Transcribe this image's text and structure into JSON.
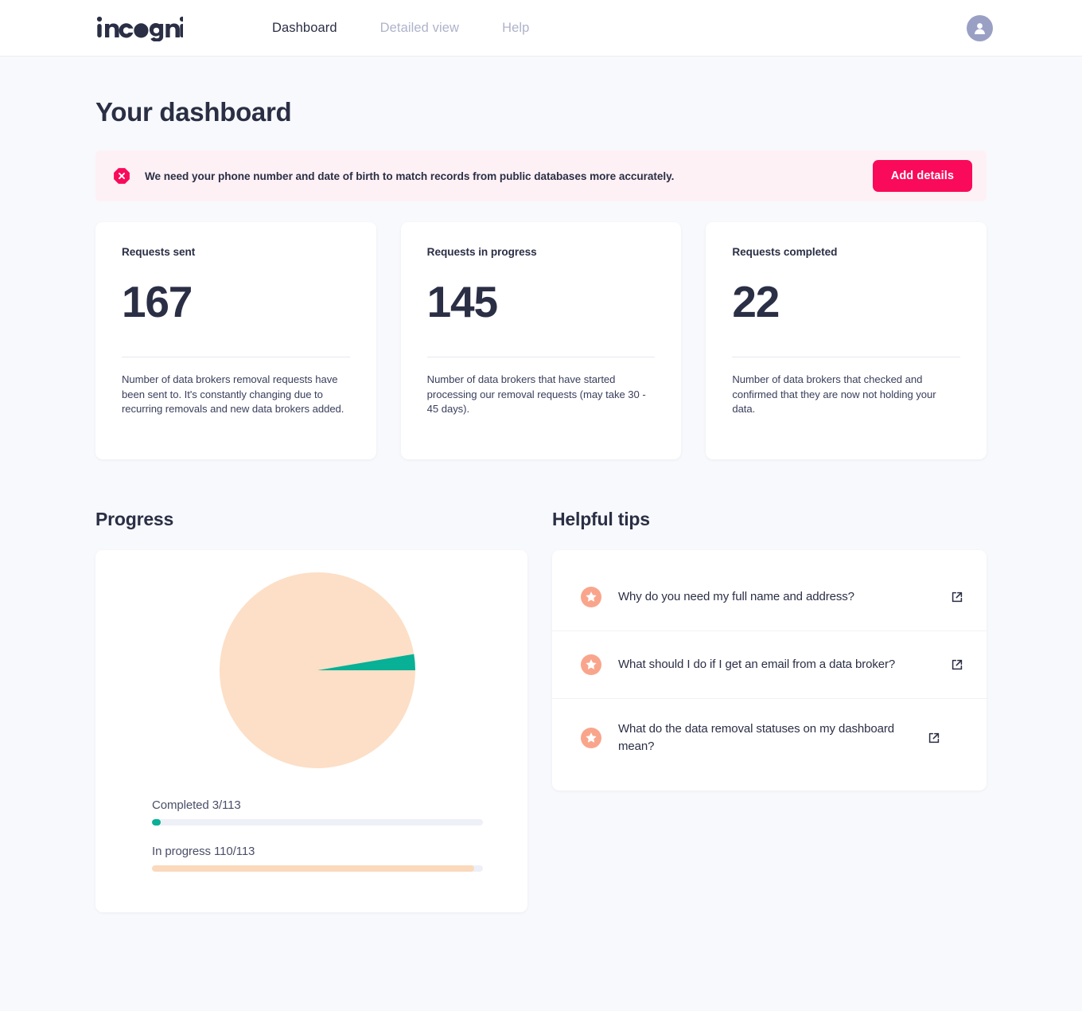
{
  "brand": {
    "name": "incogni"
  },
  "nav": {
    "items": [
      {
        "label": "Dashboard",
        "active": true
      },
      {
        "label": "Detailed view",
        "active": false
      },
      {
        "label": "Help",
        "active": false
      }
    ],
    "avatar_icon": "user-avatar-icon"
  },
  "page": {
    "title": "Your dashboard"
  },
  "alert": {
    "icon": "error-octagon-icon",
    "message": "We need your phone number and date of birth to match records from public databases more accurately.",
    "button_label": "Add details",
    "bg_color": "#fdf1f5",
    "accent_color": "#fa0a5a"
  },
  "stats": [
    {
      "label": "Requests sent",
      "value": "167",
      "description": "Number of data brokers removal requests have been sent to. It's constantly changing due to recurring removals and new data brokers added."
    },
    {
      "label": "Requests in progress",
      "value": "145",
      "description": "Number of data brokers that have started processing our removal requests (may take 30 - 45 days)."
    },
    {
      "label": "Requests completed",
      "value": "22",
      "description": "Number of data brokers that checked and confirmed that they are now not holding your data."
    }
  ],
  "progress": {
    "title": "Progress",
    "bars": [
      {
        "label": "Completed 3/113",
        "percent": 2.65,
        "color": "#08b096"
      },
      {
        "label": "In progress 110/113",
        "percent": 97.35,
        "color": "#fbd9bd"
      }
    ]
  },
  "chart_data": {
    "type": "pie",
    "title": "Progress",
    "categories": [
      "In progress",
      "Completed"
    ],
    "values": [
      110,
      3
    ],
    "total": 113,
    "percentages": [
      97.35,
      2.65
    ],
    "colors": [
      "#fcdfc6",
      "#08b096"
    ],
    "legend": "none",
    "start_angle_deg": 0,
    "direction": "clockwise",
    "labels": [
      "In progress 110/113",
      "Completed 3/113"
    ]
  },
  "tips": {
    "title": "Helpful tips",
    "items": [
      {
        "icon": "star-icon",
        "text": "Why do you need my full name and address?",
        "link_icon": "external-link-icon"
      },
      {
        "icon": "star-icon",
        "text": "What should I do if I get an email from a data broker?",
        "link_icon": "external-link-icon"
      },
      {
        "icon": "star-icon",
        "text": "What do the data removal statuses on my dashboard mean?",
        "link_icon": "external-link-icon"
      }
    ]
  },
  "colors": {
    "page_bg": "#f8f9fc",
    "card_bg": "#ffffff",
    "text_dark": "#2b2f45",
    "text_muted": "#aeb3ca",
    "teal": "#08b096",
    "peach": "#fcdfc6",
    "coral": "#f9a58c",
    "pink": "#fa0a5a"
  }
}
